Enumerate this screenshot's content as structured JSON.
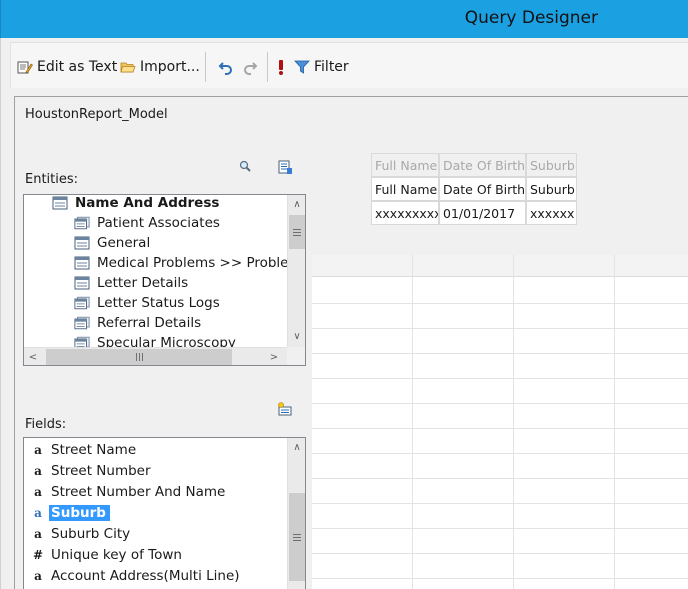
{
  "window": {
    "title": "Query Designer"
  },
  "toolbar": {
    "edit_as_text": "Edit as Text",
    "import": "Import...",
    "filter": "Filter"
  },
  "model_name": "HoustonReport_Model",
  "entities": {
    "label": "Entities:",
    "items": [
      {
        "label": "Name And Address",
        "bold": true
      },
      {
        "label": "Patient Associates"
      },
      {
        "label": "General"
      },
      {
        "label": "Medical Problems >> Problem"
      },
      {
        "label": "Letter Details"
      },
      {
        "label": "Letter Status Logs"
      },
      {
        "label": "Referral Details"
      },
      {
        "label": "Specular Microscopy"
      }
    ]
  },
  "fields": {
    "label": "Fields:",
    "items": [
      {
        "label": "Street Name",
        "icon": "text-field-icon"
      },
      {
        "label": "Street Number",
        "icon": "text-field-icon"
      },
      {
        "label": "Street Number And Name",
        "icon": "text-field-icon"
      },
      {
        "label": "Suburb",
        "icon": "text-field-icon",
        "selected": true
      },
      {
        "label": "Suburb City",
        "icon": "text-field-icon"
      },
      {
        "label": "Unique key of Town",
        "icon": "number-field-icon"
      },
      {
        "label": "Account Address(Multi Line)",
        "icon": "text-field-icon"
      }
    ]
  },
  "preview": {
    "ghost_headers": [
      "Full Name",
      "Date Of Birth",
      "Suburb"
    ],
    "headers": [
      "Full Name",
      "Date Of Birth",
      "Suburb"
    ],
    "row": [
      "xxxxxxxxx",
      "01/01/2017",
      "xxxxxx"
    ]
  }
}
